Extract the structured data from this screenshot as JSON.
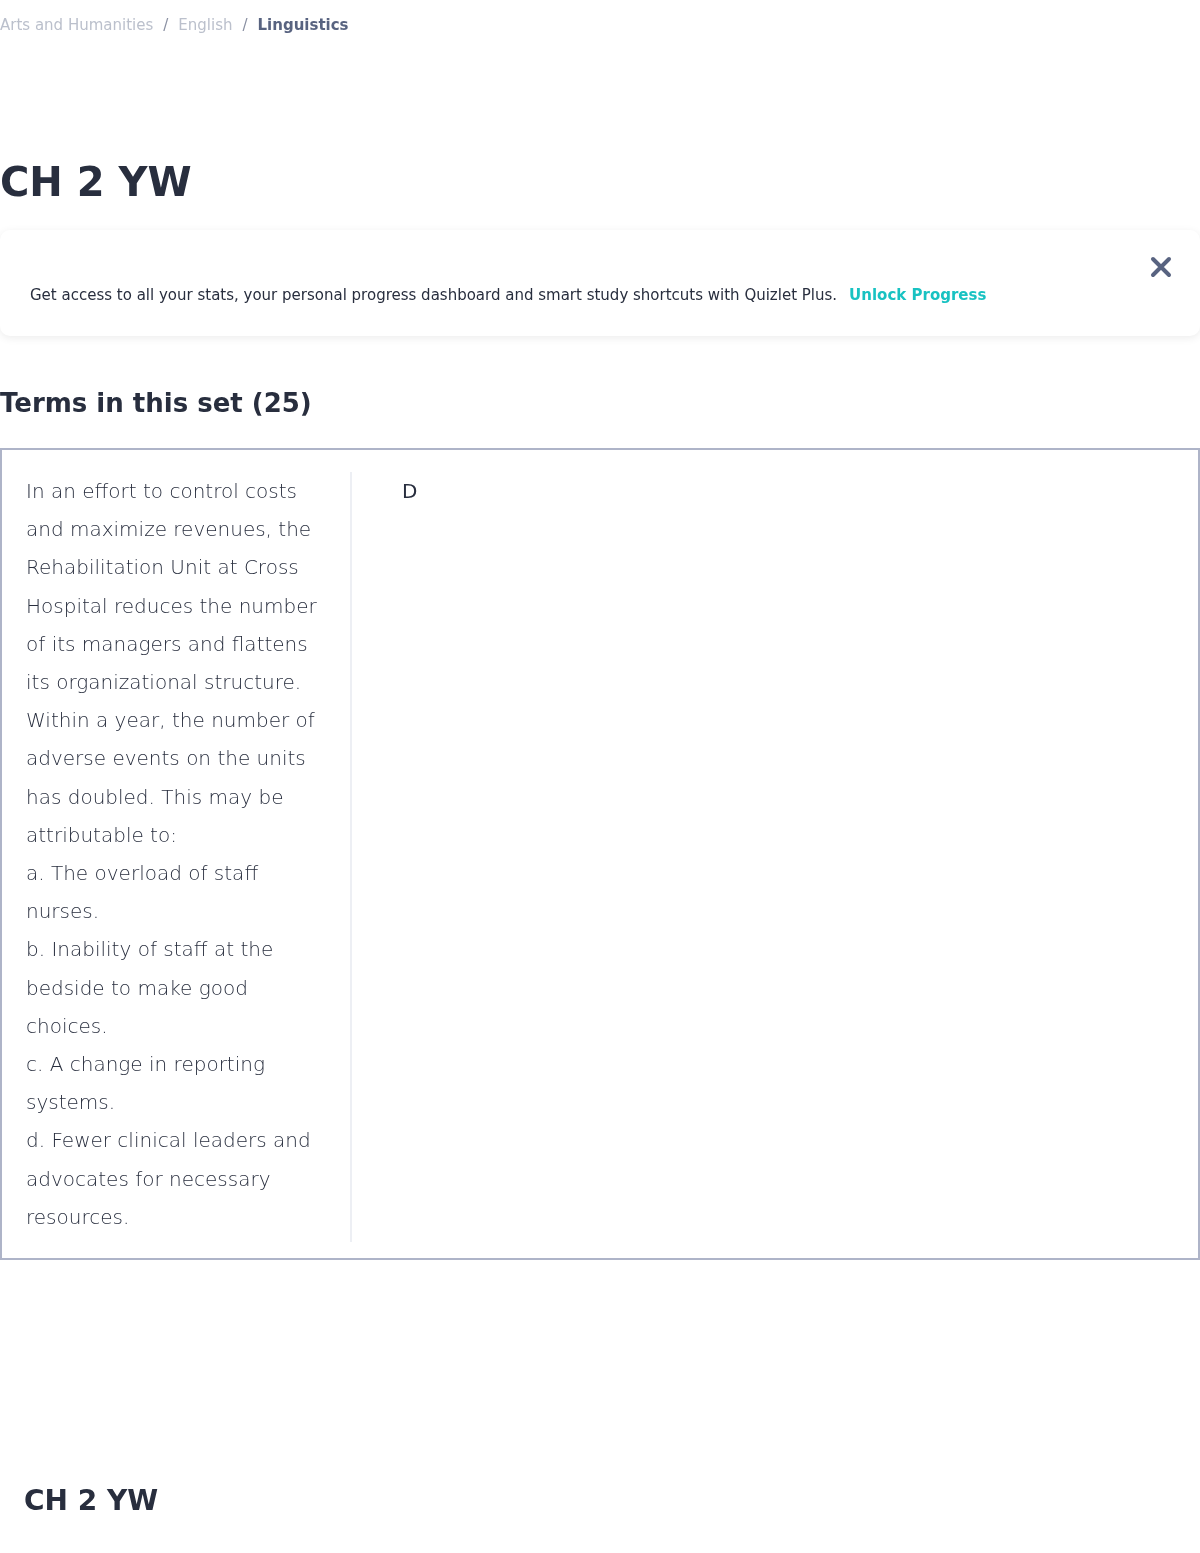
{
  "breadcrumbs": [
    {
      "label": "Arts and Humanities"
    },
    {
      "label": "English"
    },
    {
      "label": "Linguistics"
    }
  ],
  "breadcrumb_separator": "/",
  "title": "CH 2 YW",
  "banner": {
    "text": "Get access to all your stats, your personal progress dashboard and smart study shortcuts with Quizlet Plus.",
    "link": "Unlock Progress"
  },
  "terms_heading": "Terms in this set (25)",
  "terms": [
    {
      "term": [
        "In an effort to control costs and maximize revenues, the Rehabilitation Unit at Cross Hospital reduces the number of its managers and flattens its organizational structure. Within a year, the number of adverse events on the units has doubled. This may be attributable to:",
        "a. The overload of staff nurses.",
        "b. Inability of staff at the bedside to make good choices.",
        "c. A change in reporting systems.",
        "d. Fewer clinical leaders and advocates for necessary resources."
      ],
      "definition": "D"
    }
  ],
  "footer_title": "CH 2 YW"
}
